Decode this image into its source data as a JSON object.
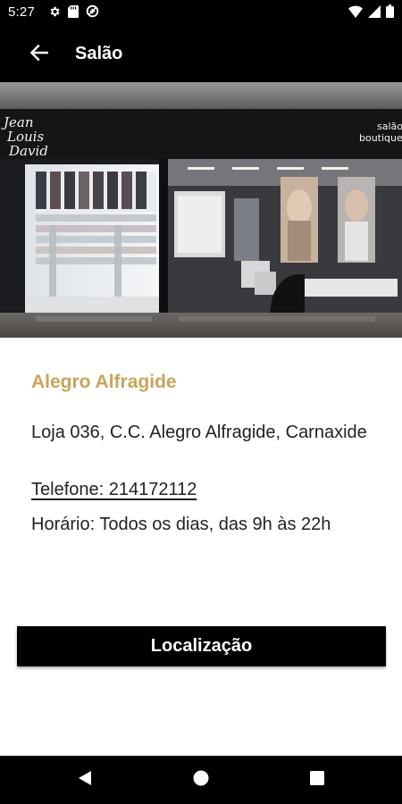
{
  "status_bar": {
    "time": "5:27",
    "left_icons": [
      "settings-icon",
      "sd-card-icon",
      "data-saver-icon"
    ],
    "right_icons": [
      "wifi-icon",
      "signal-icon",
      "battery-icon"
    ]
  },
  "app_bar": {
    "title": "Salão",
    "back_icon": "arrow-left-icon"
  },
  "hero": {
    "left_sign": "Jean Louis David",
    "right_sign": "salão boutique"
  },
  "store": {
    "name": "Alegro Alfragide",
    "address": "Loja 036, C.C. Alegro Alfragide, Carnaxide",
    "phone": "Telefone: 214172112",
    "hours": "Horário: Todos os dias, das 9h às 22h"
  },
  "actions": {
    "location_label": "Localização"
  },
  "colors": {
    "accent": "#c8a45d",
    "bar": "#000000",
    "text": "#222222"
  },
  "nav_bar": {
    "icons": [
      "back-triangle-icon",
      "home-circle-icon",
      "recents-square-icon"
    ]
  }
}
